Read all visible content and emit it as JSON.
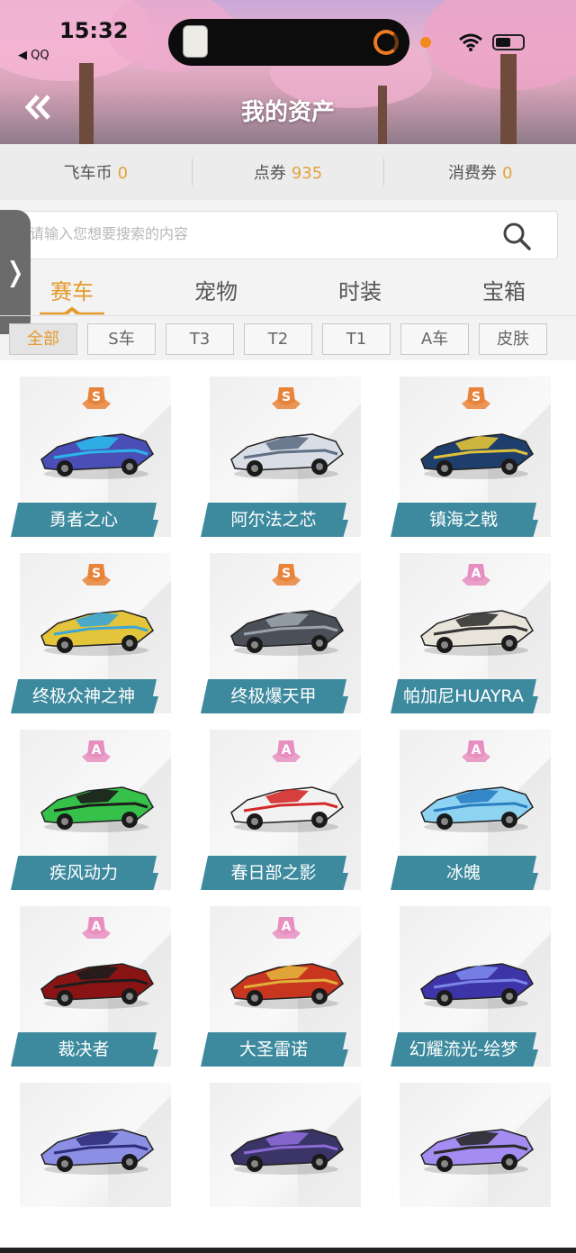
{
  "status_bar": {
    "time": "15:32",
    "carrier": "◀ QQ"
  },
  "header": {
    "title": "我的资产",
    "back_icon": "double-chevron-left-icon"
  },
  "currency": [
    {
      "label": "飞车币",
      "value": "0"
    },
    {
      "label": "点券",
      "value": "935"
    },
    {
      "label": "消费券",
      "value": "0"
    }
  ],
  "search": {
    "placeholder": "请输入您想要搜索的内容"
  },
  "side_handle": {
    "glyph": "❭"
  },
  "tabs": [
    {
      "label": "赛车",
      "active": true
    },
    {
      "label": "宠物",
      "active": false
    },
    {
      "label": "时装",
      "active": false
    },
    {
      "label": "宝箱",
      "active": false
    }
  ],
  "filters": [
    {
      "label": "全部",
      "active": true
    },
    {
      "label": "S车",
      "active": false
    },
    {
      "label": "T3",
      "active": false
    },
    {
      "label": "T2",
      "active": false
    },
    {
      "label": "T1",
      "active": false
    },
    {
      "label": "A车",
      "active": false
    },
    {
      "label": "皮肤",
      "active": false
    }
  ],
  "colors": {
    "accent": "#e49a2e",
    "ribbon": "#3d8a9e",
    "s_badge": "#e8833a",
    "a_badge": "#e78fc0"
  },
  "cars": [
    {
      "name": "勇者之心",
      "rank": "S",
      "color": "#4a4fb8",
      "accent": "#2bb6e8"
    },
    {
      "name": "阿尔法之芯",
      "rank": "S",
      "color": "#d8dde6",
      "accent": "#5f6f84"
    },
    {
      "name": "镇海之戟",
      "rank": "S",
      "color": "#1e3f6b",
      "accent": "#e0c23a"
    },
    {
      "name": "终极众神之神",
      "rank": "S",
      "color": "#e3c43a",
      "accent": "#3aa7d8"
    },
    {
      "name": "终极爆天甲",
      "rank": "S",
      "color": "#4b4f58",
      "accent": "#9aa3ad"
    },
    {
      "name": "帕加尼HUAYRA",
      "rank": "A",
      "color": "#e9e4da",
      "accent": "#333333"
    },
    {
      "name": "疾风动力",
      "rank": "A",
      "color": "#36c24a",
      "accent": "#1c1c1c"
    },
    {
      "name": "春日部之影",
      "rank": "A",
      "color": "#f2f2f2",
      "accent": "#d42a2a"
    },
    {
      "name": "冰魄",
      "rank": "A",
      "color": "#8fd3f2",
      "accent": "#2a7fc2"
    },
    {
      "name": "裁决者",
      "rank": "A",
      "color": "#8a1414",
      "accent": "#1c1c1c"
    },
    {
      "name": "大圣雷诺",
      "rank": "A",
      "color": "#c8361f",
      "accent": "#e2b03a"
    },
    {
      "name": "幻耀流光-绘梦",
      "rank": "",
      "color": "#3d34a8",
      "accent": "#7b86e8"
    },
    {
      "name": "",
      "rank": "",
      "color": "#8c8fe3",
      "accent": "#2e2e7a"
    },
    {
      "name": "",
      "rank": "",
      "color": "#3b3466",
      "accent": "#8d6ad6"
    },
    {
      "name": "",
      "rank": "",
      "color": "#a48cf0",
      "accent": "#2a2a2a"
    }
  ]
}
